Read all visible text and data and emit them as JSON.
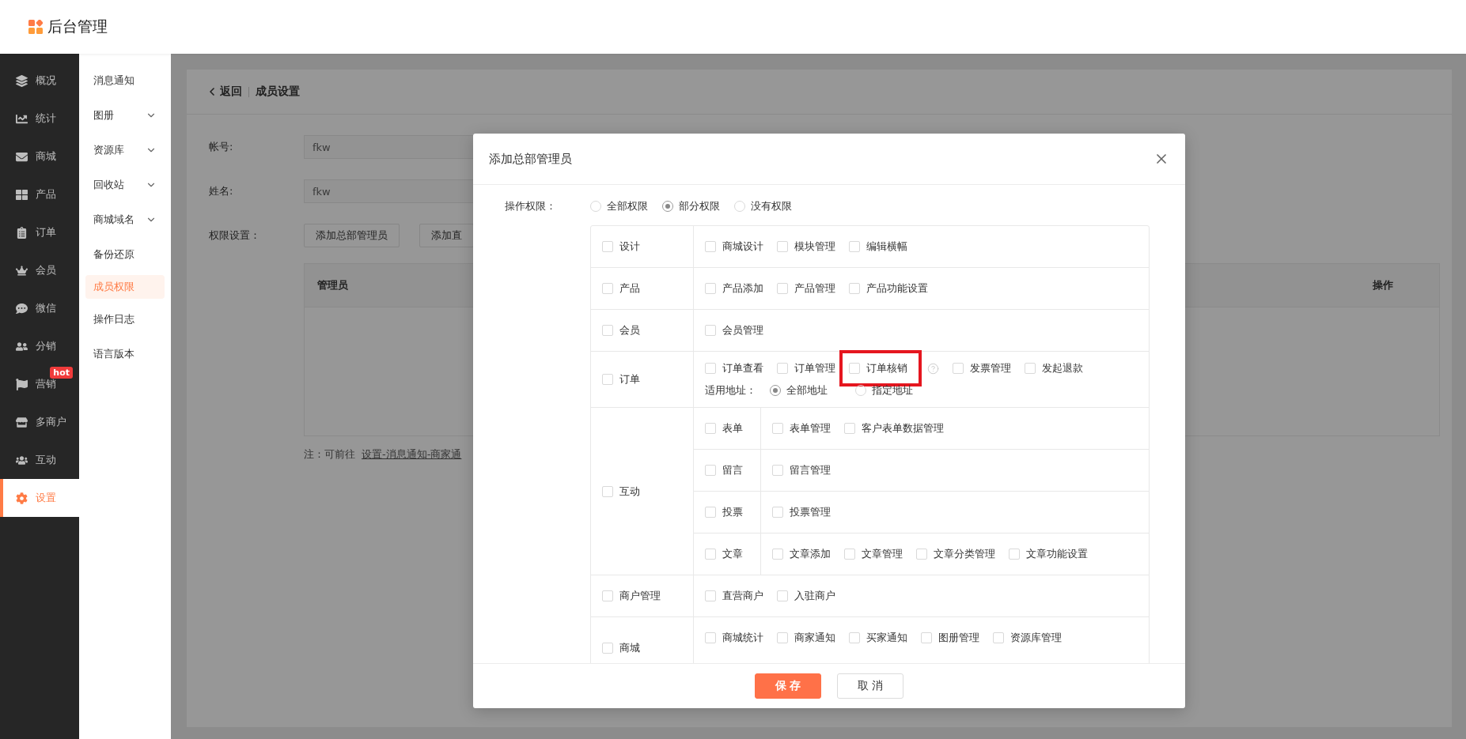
{
  "header": {
    "title": "后台管理"
  },
  "nav": [
    {
      "label": "概况",
      "selected": false
    },
    {
      "label": "统计",
      "selected": false
    },
    {
      "label": "商城",
      "selected": false
    },
    {
      "label": "产品",
      "selected": false
    },
    {
      "label": "订单",
      "selected": false
    },
    {
      "label": "会员",
      "selected": false
    },
    {
      "label": "微信",
      "selected": false
    },
    {
      "label": "分销",
      "selected": false
    },
    {
      "label": "营销",
      "selected": false,
      "badge": "hot"
    },
    {
      "label": "多商户",
      "selected": false
    },
    {
      "label": "互动",
      "selected": false
    },
    {
      "label": "设置",
      "selected": true
    }
  ],
  "subnav": [
    {
      "label": "消息通知",
      "expandable": false,
      "selected": false
    },
    {
      "label": "图册",
      "expandable": true,
      "selected": false
    },
    {
      "label": "资源库",
      "expandable": true,
      "selected": false
    },
    {
      "label": "回收站",
      "expandable": true,
      "selected": false
    },
    {
      "label": "商城域名",
      "expandable": true,
      "selected": false
    },
    {
      "label": "备份还原",
      "expandable": false,
      "selected": false
    },
    {
      "label": "成员权限",
      "expandable": false,
      "selected": true
    },
    {
      "label": "操作日志",
      "expandable": false,
      "selected": false
    },
    {
      "label": "语言版本",
      "expandable": false,
      "selected": false
    }
  ],
  "page": {
    "back": "返回",
    "title": "成员设置",
    "fields": [
      {
        "label": "帐号:",
        "value": "fkw"
      },
      {
        "label": "姓名:",
        "value": "fkw"
      }
    ],
    "permission_label": "权限设置：",
    "buttons": [
      "添加总部管理员",
      "添加直"
    ],
    "table": {
      "columns": [
        "管理员",
        "操作"
      ]
    },
    "note": {
      "text": "注：可前往",
      "link": "设置-消息通知-商家通"
    }
  },
  "dialog": {
    "title": "添加总部管理员",
    "scope_label": "操作权限：",
    "scope_options": [
      {
        "label": "全部权限",
        "selected": false
      },
      {
        "label": "部分权限",
        "selected": true
      },
      {
        "label": "没有权限",
        "selected": false
      }
    ],
    "categories": [
      {
        "kind": "simple",
        "label": "设计",
        "checked": false,
        "items": [
          {
            "label": "商城设计",
            "checked": false
          },
          {
            "label": "模块管理",
            "checked": false
          },
          {
            "label": "编辑横幅",
            "checked": false
          }
        ]
      },
      {
        "kind": "simple",
        "label": "产品",
        "checked": false,
        "items": [
          {
            "label": "产品添加",
            "checked": false
          },
          {
            "label": "产品管理",
            "checked": false
          },
          {
            "label": "产品功能设置",
            "checked": false
          }
        ]
      },
      {
        "kind": "simple",
        "label": "会员",
        "checked": false,
        "items": [
          {
            "label": "会员管理",
            "checked": false
          }
        ]
      },
      {
        "kind": "simple",
        "label": "订单",
        "checked": false,
        "items": [
          {
            "label": "订单查看",
            "checked": false
          },
          {
            "label": "订单管理",
            "checked": false
          },
          {
            "label": "订单核销",
            "checked": false,
            "highlighted": true,
            "help": true
          },
          {
            "label": "发票管理",
            "checked": false
          },
          {
            "label": "发起退款",
            "checked": false
          }
        ],
        "address_label": "适用地址：",
        "address_options": [
          {
            "label": "全部地址",
            "selected": true
          },
          {
            "label": "指定地址",
            "selected": false
          }
        ]
      },
      {
        "kind": "group",
        "label": "互动",
        "checked": false,
        "children": [
          {
            "label": "表单",
            "checked": false,
            "items": [
              {
                "label": "表单管理",
                "checked": false
              },
              {
                "label": "客户表单数据管理",
                "checked": false
              }
            ]
          },
          {
            "label": "留言",
            "checked": false,
            "items": [
              {
                "label": "留言管理",
                "checked": false
              }
            ]
          },
          {
            "label": "投票",
            "checked": false,
            "items": [
              {
                "label": "投票管理",
                "checked": false
              }
            ]
          },
          {
            "label": "文章",
            "checked": false,
            "items": [
              {
                "label": "文章添加",
                "checked": false
              },
              {
                "label": "文章管理",
                "checked": false
              },
              {
                "label": "文章分类管理",
                "checked": false
              },
              {
                "label": "文章功能设置",
                "checked": false
              }
            ]
          }
        ]
      },
      {
        "kind": "simple",
        "label": "商户管理",
        "checked": false,
        "items": [
          {
            "label": "直营商户",
            "checked": false
          },
          {
            "label": "入驻商户",
            "checked": false
          }
        ]
      },
      {
        "kind": "cut",
        "label": "商城",
        "checked": false,
        "items": [
          {
            "label": "商城统计",
            "checked": false
          },
          {
            "label": "商家通知",
            "checked": false
          },
          {
            "label": "买家通知",
            "checked": false
          },
          {
            "label": "图册管理",
            "checked": false
          },
          {
            "label": "资源库管理",
            "checked": false
          }
        ]
      }
    ],
    "buttons": [
      {
        "label": "保 存",
        "kind": "primary"
      },
      {
        "label": "取 消",
        "kind": "secondary"
      }
    ]
  }
}
